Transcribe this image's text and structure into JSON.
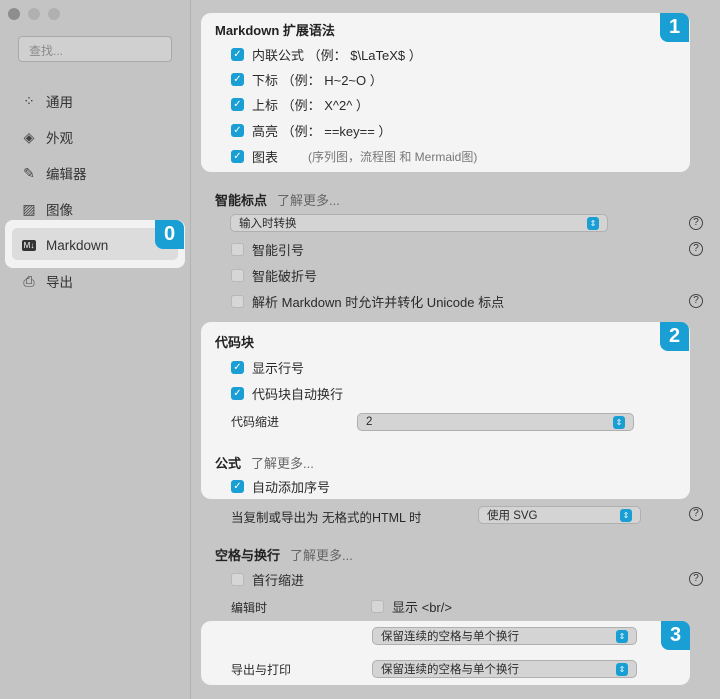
{
  "sidebar": {
    "search_placeholder": "查找...",
    "items": [
      {
        "label": "通用",
        "icon": "grid-icon"
      },
      {
        "label": "外观",
        "icon": "paint-bucket-icon"
      },
      {
        "label": "编辑器",
        "icon": "pencil-icon"
      },
      {
        "label": "图像",
        "icon": "image-icon"
      },
      {
        "label": "Markdown",
        "icon": "markdown-icon"
      },
      {
        "label": "导出",
        "icon": "printer-icon"
      }
    ],
    "selected": "Markdown"
  },
  "badges": [
    "0",
    "1",
    "2",
    "3"
  ],
  "ext": {
    "title": "Markdown 扩展语法",
    "items": [
      {
        "label": "内联公式 （例： $\\LaTeX$ ）",
        "checked": true
      },
      {
        "label": "下标 （例： H~2~O ）",
        "checked": true
      },
      {
        "label": "上标 （例： X^2^ ）",
        "checked": true
      },
      {
        "label": "高亮 （例： ==key== ）",
        "checked": true
      },
      {
        "label": "图表",
        "checked": true,
        "note": "(序列图，流程图 和 Mermaid图)"
      }
    ]
  },
  "punct": {
    "title": "智能标点",
    "learn_more": "了解更多...",
    "select": "输入时转换",
    "items": [
      {
        "label": "智能引号",
        "checked": false
      },
      {
        "label": "智能破折号",
        "checked": false
      },
      {
        "label": "解析 Markdown 时允许并转化 Unicode 标点",
        "checked": false
      }
    ]
  },
  "code": {
    "title": "代码块",
    "line_numbers": "显示行号",
    "wrap": "代码块自动换行",
    "indent_label": "代码缩进",
    "indent_value": "2"
  },
  "math": {
    "title": "公式",
    "learn_more": "了解更多...",
    "auto_number": "自动添加序号",
    "copy_label": "当复制或导出为 无格式的HTML 时",
    "copy_value": "使用 SVG"
  },
  "whitespace": {
    "title": "空格与换行",
    "learn_more": "了解更多...",
    "first_indent": "首行缩进",
    "editing_label": "编辑时",
    "show_br": "显示 <br/>",
    "editing_value": "保留连续的空格与单个换行",
    "export_label": "导出与打印",
    "export_value": "保留连续的空格与单个换行"
  },
  "help": "?",
  "colors": {
    "accent": "#1a9fd4"
  }
}
